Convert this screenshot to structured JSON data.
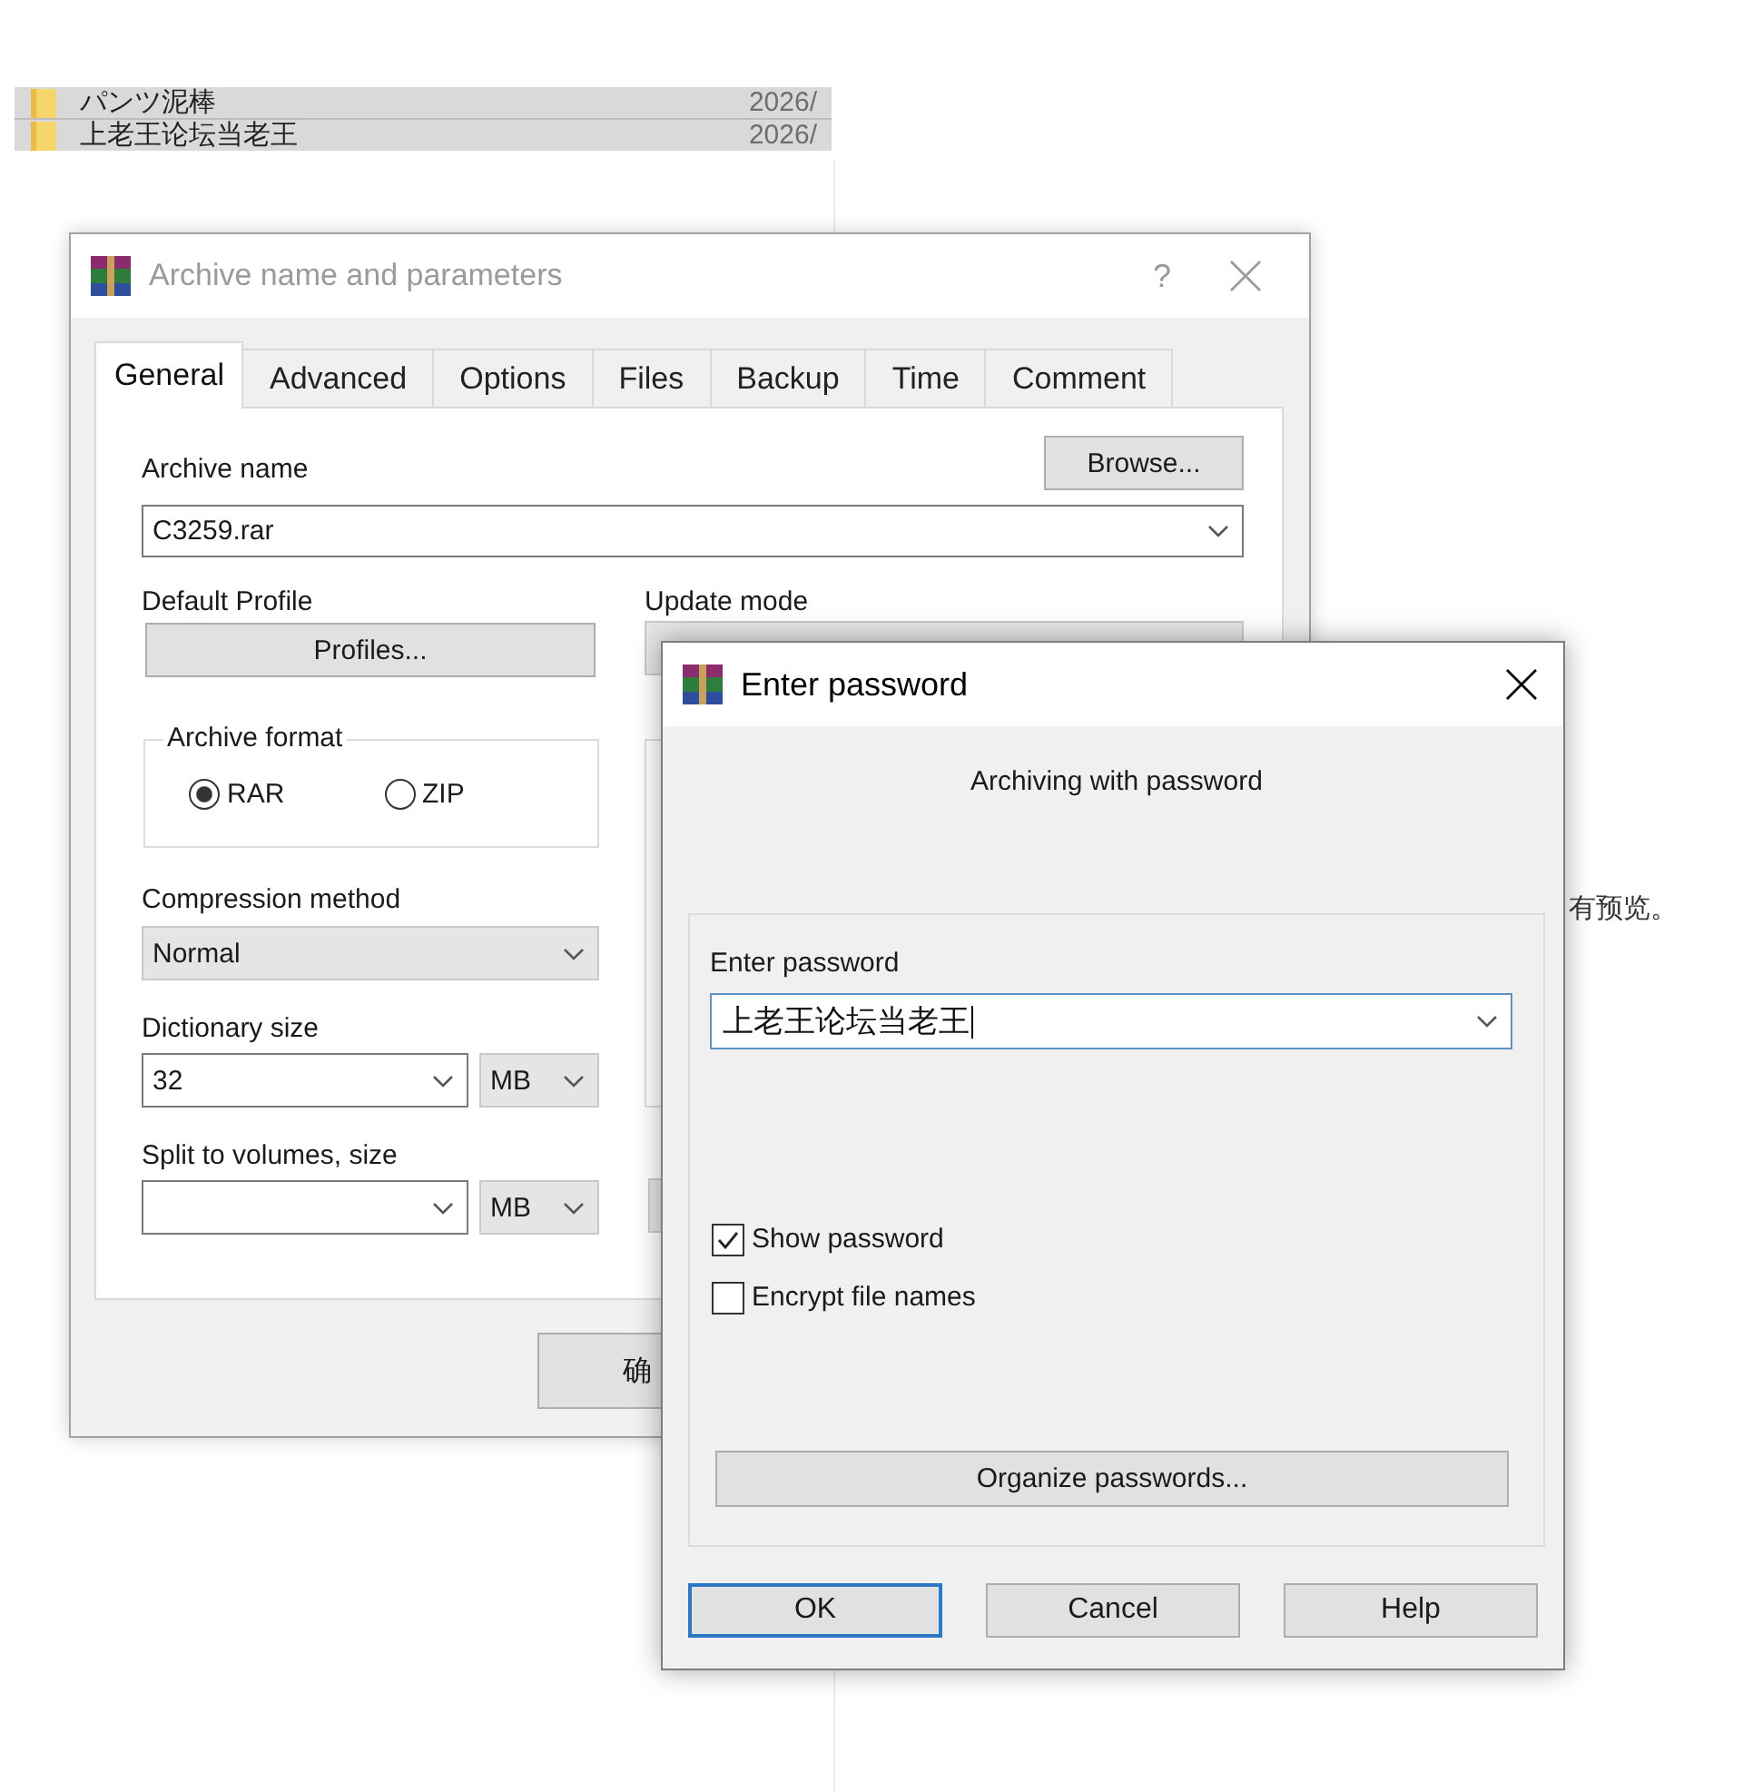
{
  "file_list": {
    "rows": [
      {
        "name": "パンツ泥棒",
        "date": "2026/",
        "selected": true
      },
      {
        "name": "上老王论坛当老王",
        "date": "2026/",
        "selected": true
      }
    ]
  },
  "background_text": "有预览。",
  "archive_dialog": {
    "title": "Archive name and parameters",
    "active": false,
    "help_button": "?",
    "tabs": [
      {
        "label": "General",
        "selected": true
      },
      {
        "label": "Advanced",
        "selected": false
      },
      {
        "label": "Options",
        "selected": false
      },
      {
        "label": "Files",
        "selected": false
      },
      {
        "label": "Backup",
        "selected": false
      },
      {
        "label": "Time",
        "selected": false
      },
      {
        "label": "Comment",
        "selected": false
      }
    ],
    "archive_name": {
      "label": "Archive name",
      "value": "C3259.rar",
      "editable": true
    },
    "browse_button": "Browse...",
    "default_profile": {
      "label": "Default Profile",
      "button": "Profiles..."
    },
    "update_mode": {
      "label": "Update mode",
      "editable": false
    },
    "archive_format": {
      "legend": "Archive format",
      "options": [
        {
          "label": "RAR",
          "selected": true
        },
        {
          "label": "ZIP",
          "selected": false
        }
      ]
    },
    "compression_method": {
      "label": "Compression method",
      "value": "Normal",
      "editable": false
    },
    "dictionary_size": {
      "label": "Dictionary size",
      "value": "32",
      "editable": true,
      "unit": "MB"
    },
    "split_volumes": {
      "label": "Split to volumes, size",
      "editable": true,
      "unit": "MB"
    },
    "buttons": [
      "确"
    ]
  },
  "password_dialog": {
    "title": "Enter password",
    "active": true,
    "heading": "Archiving with password",
    "password": {
      "label": "Enter password",
      "value": "上老王论坛当老王",
      "focused": true
    },
    "options": [
      {
        "label": "Show password",
        "checked": true
      },
      {
        "label": "Encrypt file names",
        "checked": false
      }
    ],
    "organize_button": "Organize passwords...",
    "buttons": [
      {
        "label": "OK",
        "default": true
      },
      {
        "label": "Cancel",
        "default": false
      },
      {
        "label": "Help",
        "default": false
      }
    ]
  }
}
